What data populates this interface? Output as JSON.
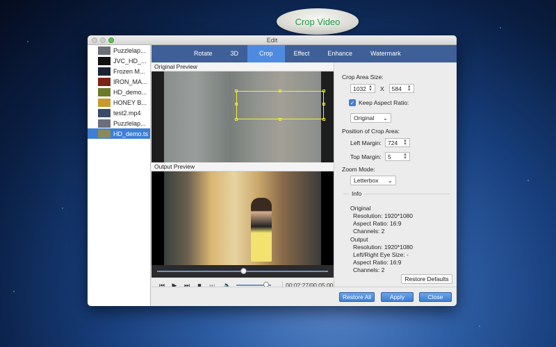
{
  "callout": {
    "text": "Crop Video"
  },
  "window": {
    "title": "Edit"
  },
  "files": [
    {
      "name": "Puzzlelap...",
      "thumb_color": "#6a6f78"
    },
    {
      "name": "JVC_HD_...",
      "thumb_color": "#111111"
    },
    {
      "name": "Frozen M...",
      "thumb_color": "#1b2333"
    },
    {
      "name": "IRON_MA...",
      "thumb_color": "#7a2418"
    },
    {
      "name": "HD_demo...",
      "thumb_color": "#6d7a2a"
    },
    {
      "name": "HONEY B...",
      "thumb_color": "#c89a2a"
    },
    {
      "name": "test2.mp4",
      "thumb_color": "#3c4a6a"
    },
    {
      "name": "Puzzlelap...",
      "thumb_color": "#6a6f78"
    },
    {
      "name": "HD_demo.ts",
      "thumb_color": "#8a8a5a",
      "selected": true
    }
  ],
  "tabs": [
    "Rotate",
    "3D",
    "Crop",
    "Effect",
    "Enhance",
    "Watermark"
  ],
  "active_tab": "Crop",
  "preview": {
    "original_label": "Original Preview",
    "output_label": "Output Preview",
    "seek_position": 0.5,
    "volume": 0.85,
    "time": "00:02:27/00:05:00"
  },
  "crop": {
    "area_size_label": "Crop Area Size:",
    "width": "1032",
    "x_label": "X",
    "height": "584",
    "keep_aspect_label": "Keep Aspect Ratio:",
    "keep_aspect_checked": true,
    "aspect_option": "Original",
    "position_label": "Position of Crop Area:",
    "left_margin_label": "Left Margin:",
    "left_margin": "724",
    "top_margin_label": "Top Margin:",
    "top_margin": "5",
    "zoom_label": "Zoom Mode:",
    "zoom_mode": "Letterbox"
  },
  "info": {
    "title": "Info",
    "original_title": "Original",
    "orig_resolution": "Resolution: 1920*1080",
    "orig_aspect": "Aspect Ratio: 16:9",
    "orig_channels": "Channels: 2",
    "output_title": "Output",
    "out_resolution": "Resolution: 1920*1080",
    "out_eye": "Left/Right Eye Size: -",
    "out_aspect": "Aspect Ratio: 16:9",
    "out_channels": "Channels: 2"
  },
  "buttons": {
    "restore_defaults": "Restore Defaults",
    "restore_all": "Restore All",
    "apply": "Apply",
    "close": "Close"
  },
  "colors": {
    "accent": "#4e8be0",
    "tabbar": "#3f5f98",
    "crop_frame": "#f3ee2f",
    "callout_text": "#1f9a48"
  }
}
